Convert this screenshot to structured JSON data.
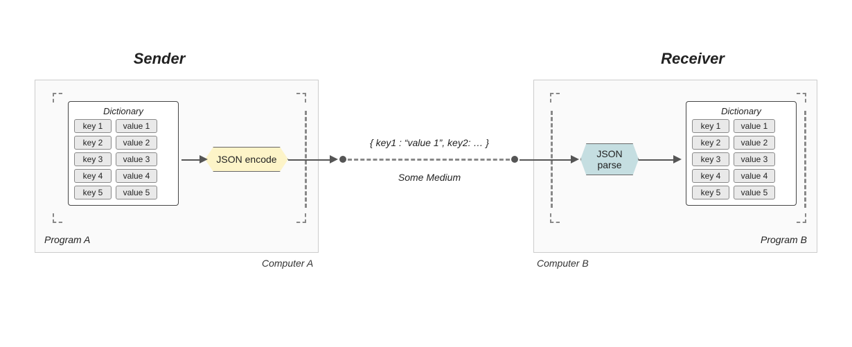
{
  "titles": {
    "sender": "Sender",
    "receiver": "Receiver"
  },
  "computers": {
    "a": "Computer A",
    "b": "Computer B"
  },
  "programs": {
    "a": "Program A",
    "b": "Program B"
  },
  "dict_label": "Dictionary",
  "dict_rows": [
    {
      "key": "key 1",
      "val": "value 1"
    },
    {
      "key": "key 2",
      "val": "value 2"
    },
    {
      "key": "key 3",
      "val": "value 3"
    },
    {
      "key": "key 4",
      "val": "value 4"
    },
    {
      "key": "key 5",
      "val": "value 5"
    }
  ],
  "nodes": {
    "encode": "JSON encode",
    "parse": "JSON\nparse"
  },
  "medium": {
    "payload": "{ key1 : “value 1”, key2: … }",
    "label": "Some Medium"
  }
}
